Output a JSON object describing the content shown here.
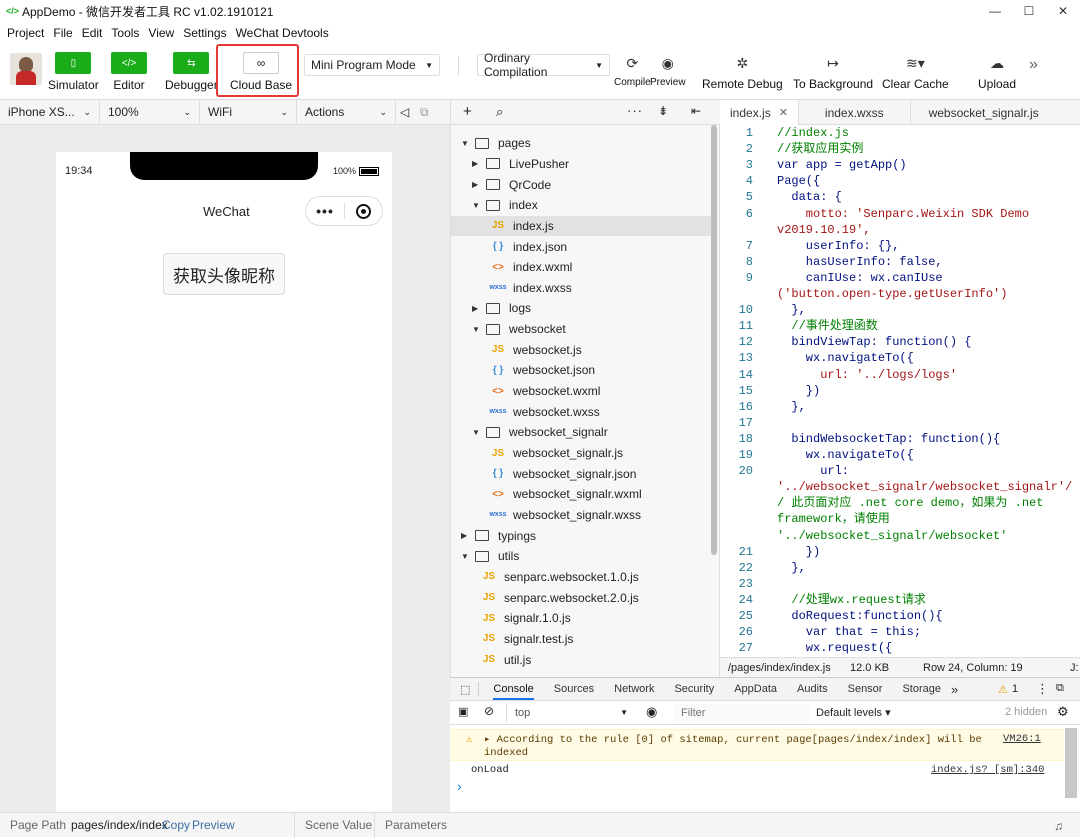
{
  "window": {
    "title": "AppDemo - 微信开发者工具 RC v1.02.1910121",
    "minimize": "—",
    "maximize": "☐",
    "close": "✕"
  },
  "menu": [
    "Project",
    "File",
    "Edit",
    "Tools",
    "View",
    "Settings",
    "WeChat Devtools"
  ],
  "toolbar": {
    "simulator": "Simulator",
    "editor": "Editor",
    "debugger": "Debugger",
    "cloud_base": "Cloud Base",
    "mode": "Mini Program Mode",
    "compilation": "Ordinary Compilation",
    "compile": "Compile",
    "preview": "Preview",
    "remote_debug": "Remote Debug",
    "to_background": "To Background",
    "clear_cache": "Clear Cache",
    "upload": "Upload",
    "more": "»"
  },
  "simbar": {
    "device": "iPhone XS...",
    "zoom": "100%",
    "network": "WiFi",
    "actions": "Actions"
  },
  "phone": {
    "time": "19:34",
    "battery": "100%",
    "nav_title": "WeChat",
    "button": "获取头像昵称"
  },
  "footer": {
    "page_path_label": "Page Path",
    "page_path": "pages/index/index",
    "copy": "Copy",
    "preview": "Preview",
    "scene_value": "Scene Value",
    "parameters": "Parameters"
  },
  "filetree": [
    {
      "name": "pages",
      "type": "folder",
      "open": true,
      "depth": 0
    },
    {
      "name": "LivePusher",
      "type": "folder",
      "open": false,
      "depth": 1
    },
    {
      "name": "QrCode",
      "type": "folder",
      "open": false,
      "depth": 1
    },
    {
      "name": "index",
      "type": "folder",
      "open": true,
      "depth": 1
    },
    {
      "name": "index.js",
      "type": "js",
      "depth": 2,
      "selected": true
    },
    {
      "name": "index.json",
      "type": "json",
      "depth": 2
    },
    {
      "name": "index.wxml",
      "type": "wxml",
      "depth": 2
    },
    {
      "name": "index.wxss",
      "type": "wxss",
      "depth": 2
    },
    {
      "name": "logs",
      "type": "folder",
      "open": false,
      "depth": 1
    },
    {
      "name": "websocket",
      "type": "folder",
      "open": true,
      "depth": 1
    },
    {
      "name": "websocket.js",
      "type": "js",
      "depth": 2
    },
    {
      "name": "websocket.json",
      "type": "json",
      "depth": 2
    },
    {
      "name": "websocket.wxml",
      "type": "wxml",
      "depth": 2
    },
    {
      "name": "websocket.wxss",
      "type": "wxss",
      "depth": 2
    },
    {
      "name": "websocket_signalr",
      "type": "folder",
      "open": true,
      "depth": 1
    },
    {
      "name": "websocket_signalr.js",
      "type": "js",
      "depth": 2
    },
    {
      "name": "websocket_signalr.json",
      "type": "json",
      "depth": 2
    },
    {
      "name": "websocket_signalr.wxml",
      "type": "wxml",
      "depth": 2
    },
    {
      "name": "websocket_signalr.wxss",
      "type": "wxss",
      "depth": 2
    },
    {
      "name": "typings",
      "type": "folder",
      "open": false,
      "depth": 0
    },
    {
      "name": "utils",
      "type": "folder",
      "open": true,
      "depth": 0
    },
    {
      "name": "senparc.websocket.1.0.js",
      "type": "js",
      "depth": 1
    },
    {
      "name": "senparc.websocket.2.0.js",
      "type": "js",
      "depth": 1
    },
    {
      "name": "signalr.1.0.js",
      "type": "js",
      "depth": 1
    },
    {
      "name": "signalr.test.js",
      "type": "js",
      "depth": 1
    },
    {
      "name": "util.js",
      "type": "js",
      "depth": 1
    }
  ],
  "icon_labels": {
    "js": "JS",
    "json": "{ }",
    "wxml": "<>",
    "wxss": "wxss"
  },
  "tabs": [
    {
      "label": "index.js",
      "close": "✕",
      "active": true
    },
    {
      "label": "index.wxss"
    },
    {
      "label": "websocket_signalr.js"
    }
  ],
  "code": [
    {
      "n": "1",
      "t": "//index.js",
      "c": "cm"
    },
    {
      "n": "2",
      "t": "//获取应用实例",
      "c": "cm"
    },
    {
      "n": "3",
      "t": "var app = getApp()",
      "c": "tx"
    },
    {
      "n": "4",
      "t": "Page({",
      "c": "tx"
    },
    {
      "n": "5",
      "t": "  data: {",
      "c": "tx"
    },
    {
      "n": "6",
      "t": "    motto: 'Senparc.Weixin SDK Demo",
      "c": "str"
    },
    {
      "n": "",
      "t": "v2019.10.19',",
      "c": "str",
      "wrap": true
    },
    {
      "n": "7",
      "t": "    userInfo: {},",
      "c": "tx"
    },
    {
      "n": "8",
      "t": "    hasUserInfo: false,",
      "c": "tx"
    },
    {
      "n": "9",
      "t": "    canIUse: wx.canIUse",
      "c": "tx"
    },
    {
      "n": "",
      "t": "('button.open-type.getUserInfo')",
      "c": "str",
      "wrap": true
    },
    {
      "n": "10",
      "t": "  },",
      "c": "tx"
    },
    {
      "n": "11",
      "t": "  //事件处理函数",
      "c": "cm"
    },
    {
      "n": "12",
      "t": "  bindViewTap: function() {",
      "c": "tx"
    },
    {
      "n": "13",
      "t": "    wx.navigateTo({",
      "c": "tx"
    },
    {
      "n": "14",
      "t": "      url: '../logs/logs'",
      "c": "str"
    },
    {
      "n": "15",
      "t": "    })",
      "c": "tx"
    },
    {
      "n": "16",
      "t": "  },",
      "c": "tx"
    },
    {
      "n": "17",
      "t": "",
      "c": "tx"
    },
    {
      "n": "18",
      "t": "  bindWebsocketTap: function(){",
      "c": "tx"
    },
    {
      "n": "19",
      "t": "    wx.navigateTo({",
      "c": "tx"
    },
    {
      "n": "20",
      "t": "      url:",
      "c": "tx"
    },
    {
      "n": "",
      "t": "'../websocket_signalr/websocket_signalr'/",
      "c": "str",
      "wrap": true
    },
    {
      "n": "",
      "t": "/ 此页面对应 .net core demo，如果为 .net",
      "c": "cm",
      "wrap": true
    },
    {
      "n": "",
      "t": "framework，请使用",
      "c": "cm",
      "wrap": true
    },
    {
      "n": "",
      "t": "'../websocket_signalr/websocket'",
      "c": "cm",
      "wrap": true
    },
    {
      "n": "21",
      "t": "    })",
      "c": "tx"
    },
    {
      "n": "22",
      "t": "  },",
      "c": "tx"
    },
    {
      "n": "23",
      "t": "",
      "c": "tx"
    },
    {
      "n": "24",
      "t": "  //处理wx.request请求",
      "c": "cm"
    },
    {
      "n": "25",
      "t": "  doRequest:function(){",
      "c": "tx"
    },
    {
      "n": "26",
      "t": "    var that = this;",
      "c": "tx"
    },
    {
      "n": "27",
      "t": "    wx.request({",
      "c": "tx"
    }
  ],
  "editor_status": {
    "path": "/pages/index/index.js",
    "size": "12.0 KB",
    "position": "Row 24, Column: 19",
    "lang": "J:"
  },
  "devtools": {
    "tabs": [
      "Console",
      "Sources",
      "Network",
      "Security",
      "AppData",
      "Audits",
      "Sensor",
      "Storage"
    ],
    "more": "»",
    "warn_count": "1",
    "context": "top",
    "filter_placeholder": "Filter",
    "levels": "Default levels ▾",
    "hidden": "2 hidden",
    "warning_text_1": "▸ According to the rule [0] of sitemap, current page[pages/index/index] will be",
    "warning_text_2": "indexed",
    "warning_source": "VM26:1",
    "log_text": "onLoad",
    "log_source": "index.js? [sm]:340",
    "prompt": "›"
  },
  "colors": {
    "accent_green": "#1aad19",
    "highlight_red": "#e53935"
  }
}
